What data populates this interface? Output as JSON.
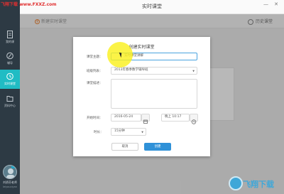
{
  "watermark_top": "飞翔下载 www.FXXZ.com",
  "watermark_bottom": "飞翔下载",
  "window": {
    "title": "实时课堂"
  },
  "sidebar": {
    "items": [
      {
        "label": "我的课"
      },
      {
        "label": "辅导"
      },
      {
        "label": "实时课堂"
      },
      {
        "label": "资料中心"
      }
    ],
    "user": {
      "name": "刘骄芬老师",
      "id": "leiyouxiyan"
    }
  },
  "toolbar": {
    "new_course_label": "新建实时课堂",
    "history_label": "历史课堂"
  },
  "dialog": {
    "title": "创建实时课堂",
    "topic_label": "课堂主题：",
    "topic_value": "实时课堂讲解",
    "class_label": "班级列表：",
    "class_value": "2013年春季数学辅导班",
    "desc_label": "课堂描述：",
    "desc_value": "",
    "start_label": "开始时间：",
    "start_date": "2016-05-24",
    "start_time": "晚上 10:17",
    "duration_label": "时长：",
    "duration_value": "15分钟",
    "cancel_label": "取消",
    "create_label": "创建"
  },
  "colors": {
    "sidebar": "#2d3a44",
    "accent": "#20bcc4",
    "primary_button": "#2f91d8"
  }
}
